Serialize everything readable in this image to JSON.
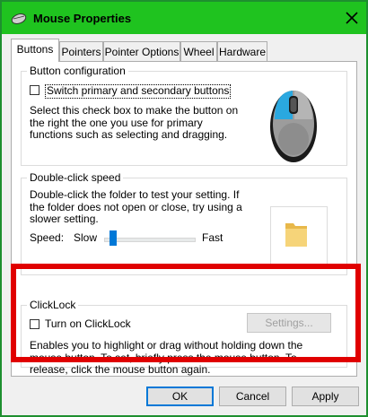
{
  "window": {
    "title": "Mouse Properties",
    "icons": {
      "app": "mouse-app-icon",
      "close": "close-icon"
    },
    "colors": {
      "titlebar": "#1fc31f",
      "highlight": "#e00000"
    }
  },
  "tabs": [
    {
      "label": "Buttons",
      "active": true
    },
    {
      "label": "Pointers"
    },
    {
      "label": "Pointer Options"
    },
    {
      "label": "Wheel"
    },
    {
      "label": "Hardware"
    }
  ],
  "button_config": {
    "title": "Button configuration",
    "switch_label": "Switch primary and secondary buttons",
    "switch_checked": false,
    "description": "Select this check box to make the button on the right the one you use for primary functions such as selecting and dragging.",
    "image": "mouse-image"
  },
  "double_click": {
    "title": "Double-click speed",
    "description": "Double-click the folder to test your setting. If the folder does not open or close, try using a slower setting.",
    "speed_label": "Speed:",
    "slow_label": "Slow",
    "fast_label": "Fast",
    "speed_level": 0.1,
    "folder_icon": "folder-icon"
  },
  "clicklock": {
    "title": "ClickLock",
    "toggle_label": "Turn on ClickLock",
    "toggle_checked": false,
    "settings_label": "Settings...",
    "settings_enabled": false,
    "description": "Enables you to highlight or drag without holding down the mouse button. To set, briefly press the mouse button. To release, click the mouse button again."
  },
  "footer": {
    "ok": "OK",
    "cancel": "Cancel",
    "apply": "Apply"
  }
}
